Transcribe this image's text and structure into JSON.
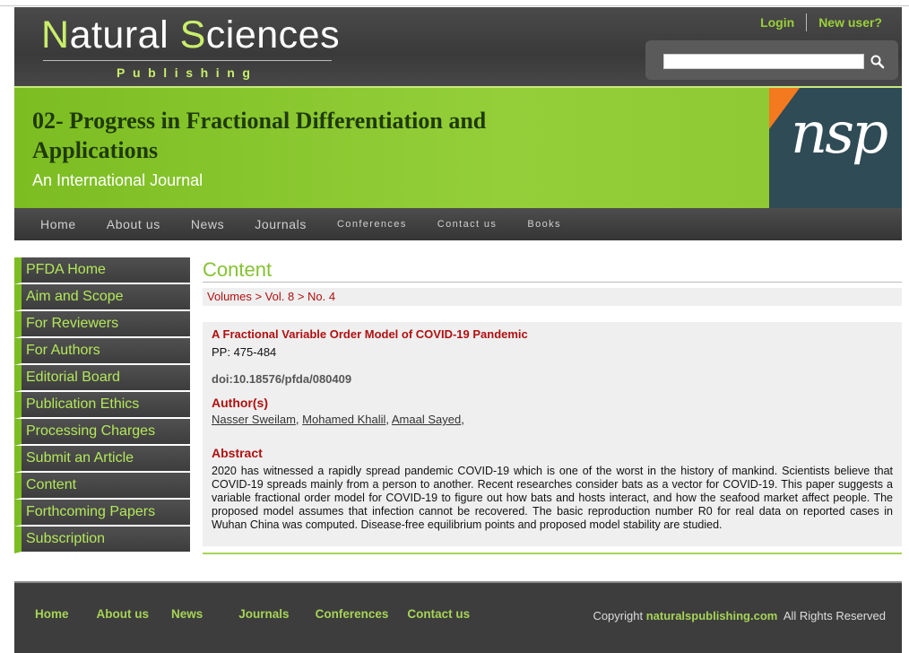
{
  "header": {
    "logo_main": "atural ",
    "logo_n": "N",
    "logo_s": "S",
    "logo_rest": "ciences",
    "logo_sub": "Publishing",
    "login": "Login",
    "new_user": "New user?",
    "search_value": ""
  },
  "banner": {
    "title": "02- Progress in Fractional Differentiation and Applications",
    "subtitle": "An International Journal",
    "logo_text": "nsp"
  },
  "nav": [
    "Home",
    "About us",
    "News",
    "Journals",
    "Conferences",
    "Contact us",
    "Books"
  ],
  "sidebar": [
    "PFDA Home",
    "Aim and Scope",
    "For Reviewers",
    "For Authors",
    "Editorial Board",
    "Publication Ethics",
    "Processing Charges",
    "Submit an Article",
    "Content",
    "Forthcoming Papers",
    "Subscription"
  ],
  "content": {
    "heading": "Content",
    "breadcrumb": "Volumes > Vol. 8 > No. 4",
    "article": {
      "title": "A Fractional Variable Order Model of COVID-19 Pandemic",
      "pp": "PP: 475-484",
      "doi": "doi:10.18576/pfda/080409",
      "authors_heading": "Author(s)",
      "authors": [
        "Nasser Sweilam",
        "Mohamed Khalil",
        "Amaal Sayed"
      ],
      "abstract_heading": "Abstract",
      "abstract": "2020 has witnessed a rapidly spread pandemic COVID-19 which is one of the worst in the history of mankind. Scientists believe that COVID-19 spreads mainly from a person to another. Recent researches consider bats as a vector for COVID-19. This paper suggests a variable fractional order model for COVID-19 to figure out how bats and hosts interact, and how the seafood market affect people. The proposed model assumes that infection cannot be recovered. The basic reproduction number R0 for real data on reported cases in Wuhan China was computed. Disease-free equilibrium points and proposed model stability are studied."
    }
  },
  "footer": {
    "links": [
      "Home",
      "About us",
      "News",
      "Journals",
      "Conferences",
      "Contact us"
    ],
    "copyright_prefix": "Copyright",
    "copyright_site": "naturalspublishing.com",
    "copyright_suffix": "All Rights Reserved"
  },
  "colors": {
    "accent_green": "#86c232",
    "title_red": "#b01010",
    "dark_bar": "#3d3d3d",
    "nsp_orange": "#f47a20"
  }
}
